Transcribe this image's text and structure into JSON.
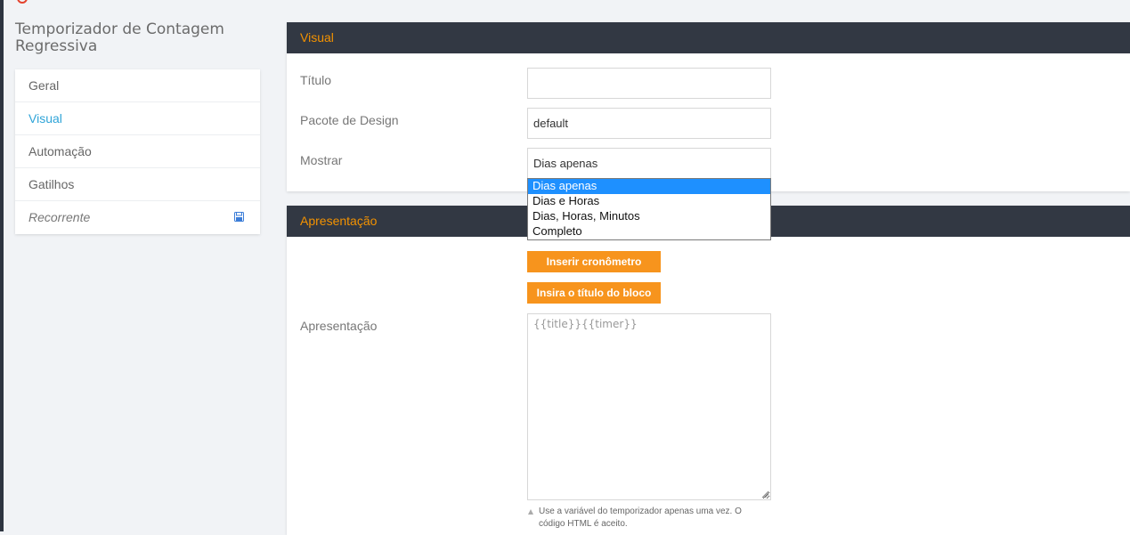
{
  "app": {
    "title": "Temporizador de Contagem Regressiva"
  },
  "sidebar": {
    "items": [
      {
        "label": "Geral"
      },
      {
        "label": "Visual"
      },
      {
        "label": "Automação"
      },
      {
        "label": "Gatilhos"
      },
      {
        "label": "Recorrente"
      }
    ],
    "active_index": 1
  },
  "visual_panel": {
    "header": "Visual",
    "titulo_label": "Título",
    "titulo_value": "",
    "design_label": "Pacote de Design",
    "design_value": "default",
    "mostrar_label": "Mostrar",
    "mostrar_value": "Dias apenas",
    "mostrar_options": [
      "Dias apenas",
      "Dias e Horas",
      "Dias, Horas, Minutos",
      "Completo"
    ],
    "mostrar_highlighted": "Dias apenas"
  },
  "apresentacao_panel": {
    "header": "Apresentação",
    "insert_timer_button": "Inserir cronômetro",
    "insert_title_button": "Insira o título do bloco",
    "apresentacao_label": "Apresentação",
    "apresentacao_value": "{{title}}{{timer}}",
    "hint": "Use a variável do temporizador apenas uma vez. O código HTML é aceito."
  },
  "colors": {
    "accent_orange": "#f7941d",
    "panel_header_bg": "#323843",
    "active_link": "#2fa4d8",
    "dropdown_highlight": "#1e90ff"
  },
  "icons": {
    "save": "floppy-disk-icon",
    "hint": "triangle-up-icon"
  }
}
